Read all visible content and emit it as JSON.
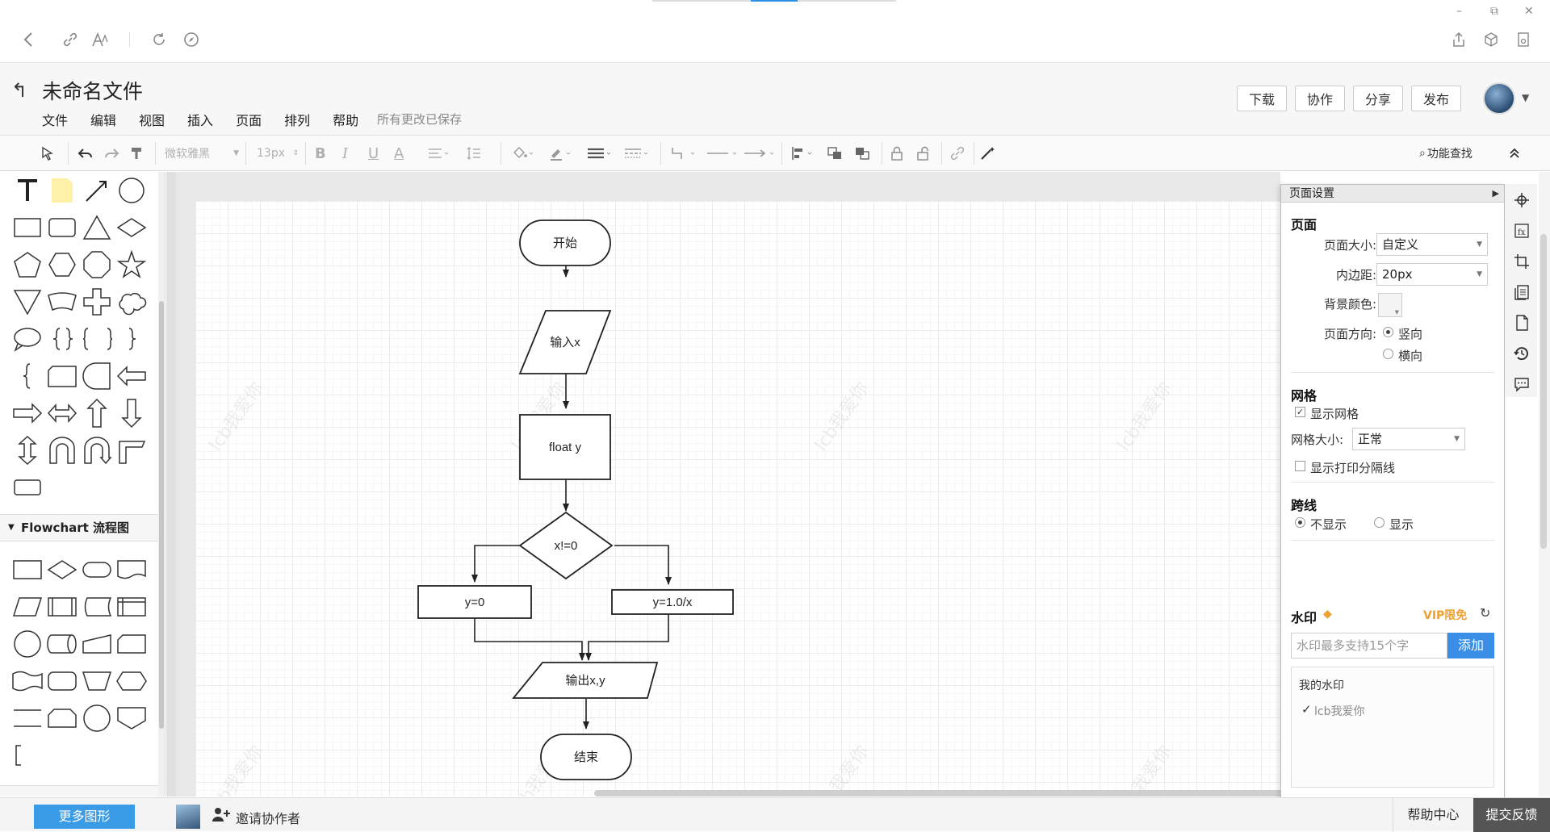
{
  "browser": {
    "back_icon": "chevron-left-icon",
    "link_icon": "link-icon",
    "font_icon": "text-size-icon",
    "reload_icon": "reload-icon",
    "compass_icon": "compass-icon",
    "window_minimize": "–",
    "window_restore": "⧉",
    "window_close": "✕"
  },
  "header": {
    "title": "未命名文件",
    "menu": [
      "文件",
      "编辑",
      "视图",
      "插入",
      "页面",
      "排列",
      "帮助"
    ],
    "save_status": "所有更改已保存",
    "buttons": {
      "download": "下载",
      "collaborate": "协作",
      "share": "分享",
      "publish": "发布"
    }
  },
  "toolbar": {
    "font_family": "微软雅黑",
    "font_size": "13px",
    "bold": "B",
    "italic": "I",
    "underline": "U",
    "font_color": "A",
    "feature_search": "功能查找"
  },
  "left_panel": {
    "flowchart_section": "Flowchart 流程图"
  },
  "diagram": {
    "nodes": {
      "start": "开始",
      "input": "输入x",
      "process": "float y",
      "decision": "x!=0",
      "yes_branch": "y=0",
      "no_branch": "y=1.0/x",
      "output": "输出x,y",
      "end": "结束"
    },
    "watermark": "lcb我爱你"
  },
  "settings": {
    "panel_title": "页面设置",
    "page_section": "页面",
    "page_size_label": "页面大小:",
    "page_size_value": "自定义",
    "padding_label": "内边距:",
    "padding_value": "20px",
    "bg_color_label": "背景颜色:",
    "orientation_label": "页面方向:",
    "portrait": "竖向",
    "landscape": "横向",
    "grid_section": "网格",
    "show_grid": "显示网格",
    "grid_size_label": "网格大小:",
    "grid_size_value": "正常",
    "show_print_lines": "显示打印分隔线",
    "jump_section": "跨线",
    "jump_hide": "不显示",
    "jump_show": "显示",
    "watermark_section": "水印",
    "vip_label": "VIP限免",
    "watermark_placeholder": "水印最多支持15个字",
    "add_button": "添加",
    "my_watermark": "我的水印",
    "watermark_item": "lcb我爱你"
  },
  "bottom": {
    "more_shapes": "更多图形",
    "invite": "邀请协作者",
    "help_center": "帮助中心",
    "feedback": "提交反馈"
  }
}
